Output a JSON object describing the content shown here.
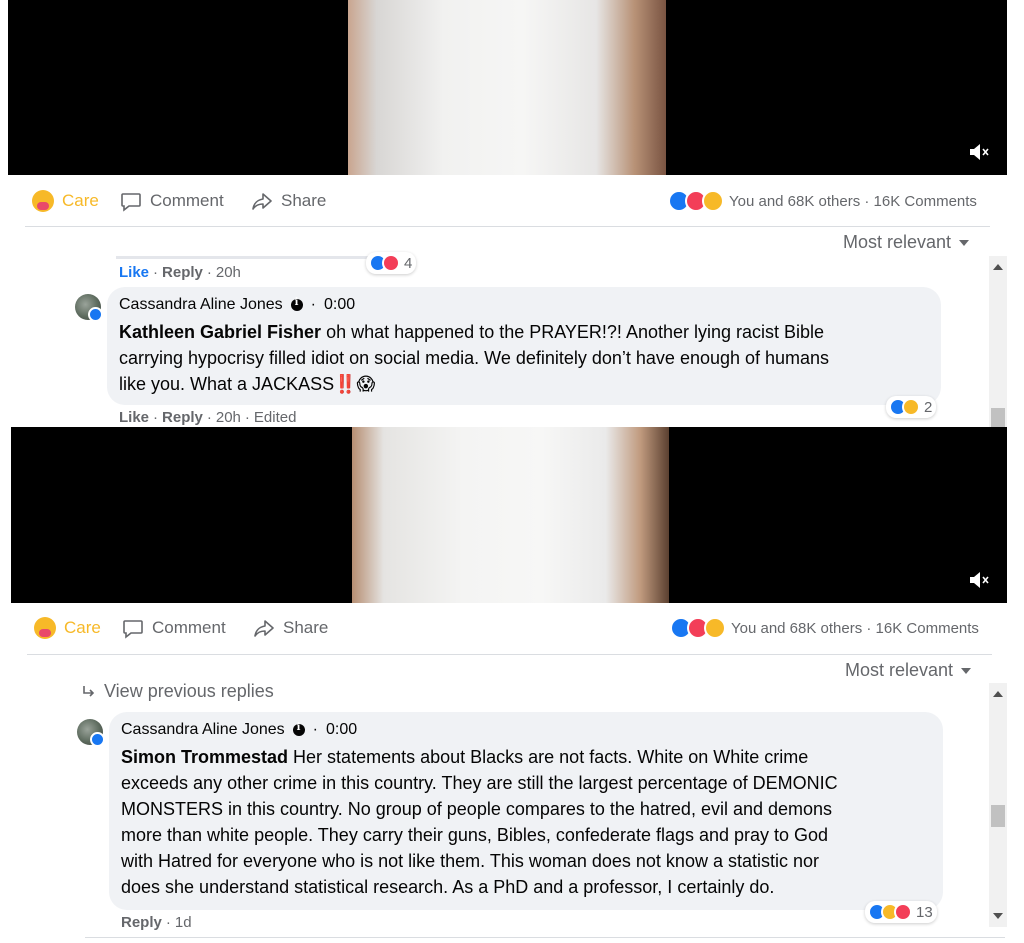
{
  "panels": [
    {
      "actions": {
        "care": "Care",
        "comment": "Comment",
        "share": "Share"
      },
      "reactions_summary": "You and 68K others · 16K Comments",
      "sort_label": "Most relevant",
      "prev_meta": {
        "like": "Like",
        "reply": "Reply",
        "time": "20h",
        "reaction_count": "4"
      },
      "comment": {
        "author": "Cassandra Aline Jones",
        "time": "0:00",
        "mention": "Kathleen Gabriel Fisher",
        "lines": [
          " oh what happened to the PRAYER!?! Another lying racist Bible",
          "carrying hypocrisy filled idiot on social media. We definitely don’t have enough of humans",
          "like you. What a JACKASS‼️😱"
        ],
        "meta_like": "Like",
        "meta_reply": "Reply",
        "meta_time": "20h",
        "meta_edited": "Edited",
        "reaction_count": "2"
      }
    },
    {
      "actions": {
        "care": "Care",
        "comment": "Comment",
        "share": "Share"
      },
      "reactions_summary": "You and 68K others · 16K Comments",
      "sort_label": "Most relevant",
      "view_previous": "View previous replies",
      "comment": {
        "author": "Cassandra Aline Jones",
        "time": "0:00",
        "mention": "Simon Trommestad",
        "lines": [
          " Her statements about Blacks are not facts. White on White crime",
          "exceeds any other crime in this country. They are still the largest percentage of DEMONIC",
          "MONSTERS in this country. No group of people compares to the hatred, evil and demons",
          "more than white people. They carry their guns, Bibles, confederate flags and pray to God",
          "with Hatred for everyone who is not like them. This woman does not know a statistic nor",
          "does she understand statistical research. As a PhD and a professor, I certainly do."
        ],
        "meta_reply": "Reply",
        "meta_time": "1d",
        "reaction_count": "13"
      }
    }
  ],
  "colors": {
    "care": "#f7b928",
    "like_blue": "#1877f2",
    "muted_text": "#65676b",
    "bubble_bg": "#f0f2f5"
  },
  "icons": [
    "care-emoji-icon",
    "comment-icon",
    "share-icon",
    "mute-icon",
    "chevron-down-icon",
    "reply-arrow-icon",
    "info-icon",
    "scroll-up-icon",
    "scroll-down-icon"
  ]
}
